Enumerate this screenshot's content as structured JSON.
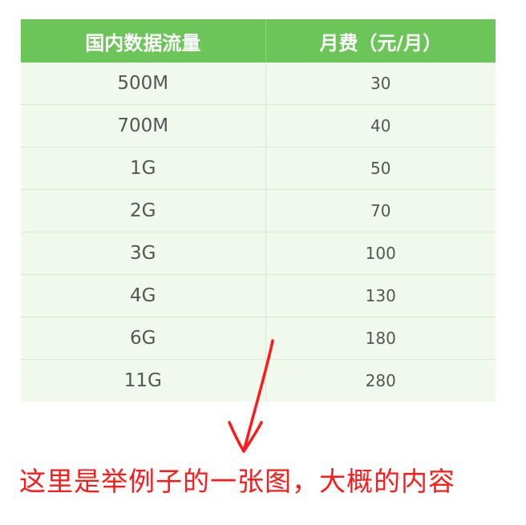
{
  "table": {
    "headers": [
      "国内数据流量",
      "月费（元/月）"
    ],
    "rows": [
      [
        "500M",
        "30"
      ],
      [
        "700M",
        "40"
      ],
      [
        "1G",
        "50"
      ],
      [
        "2G",
        "70"
      ],
      [
        "3G",
        "100"
      ],
      [
        "4G",
        "130"
      ],
      [
        "6G",
        "180"
      ],
      [
        "11G",
        "280"
      ]
    ]
  },
  "annotation": {
    "text": "这里是举例子的一张图，大概的内容",
    "color": "#ff1a1a",
    "arrow_icon": "hand-drawn-arrow-down-icon"
  },
  "colors": {
    "header_bg": "#6cc558",
    "row_bg": "#f1f9ee"
  }
}
